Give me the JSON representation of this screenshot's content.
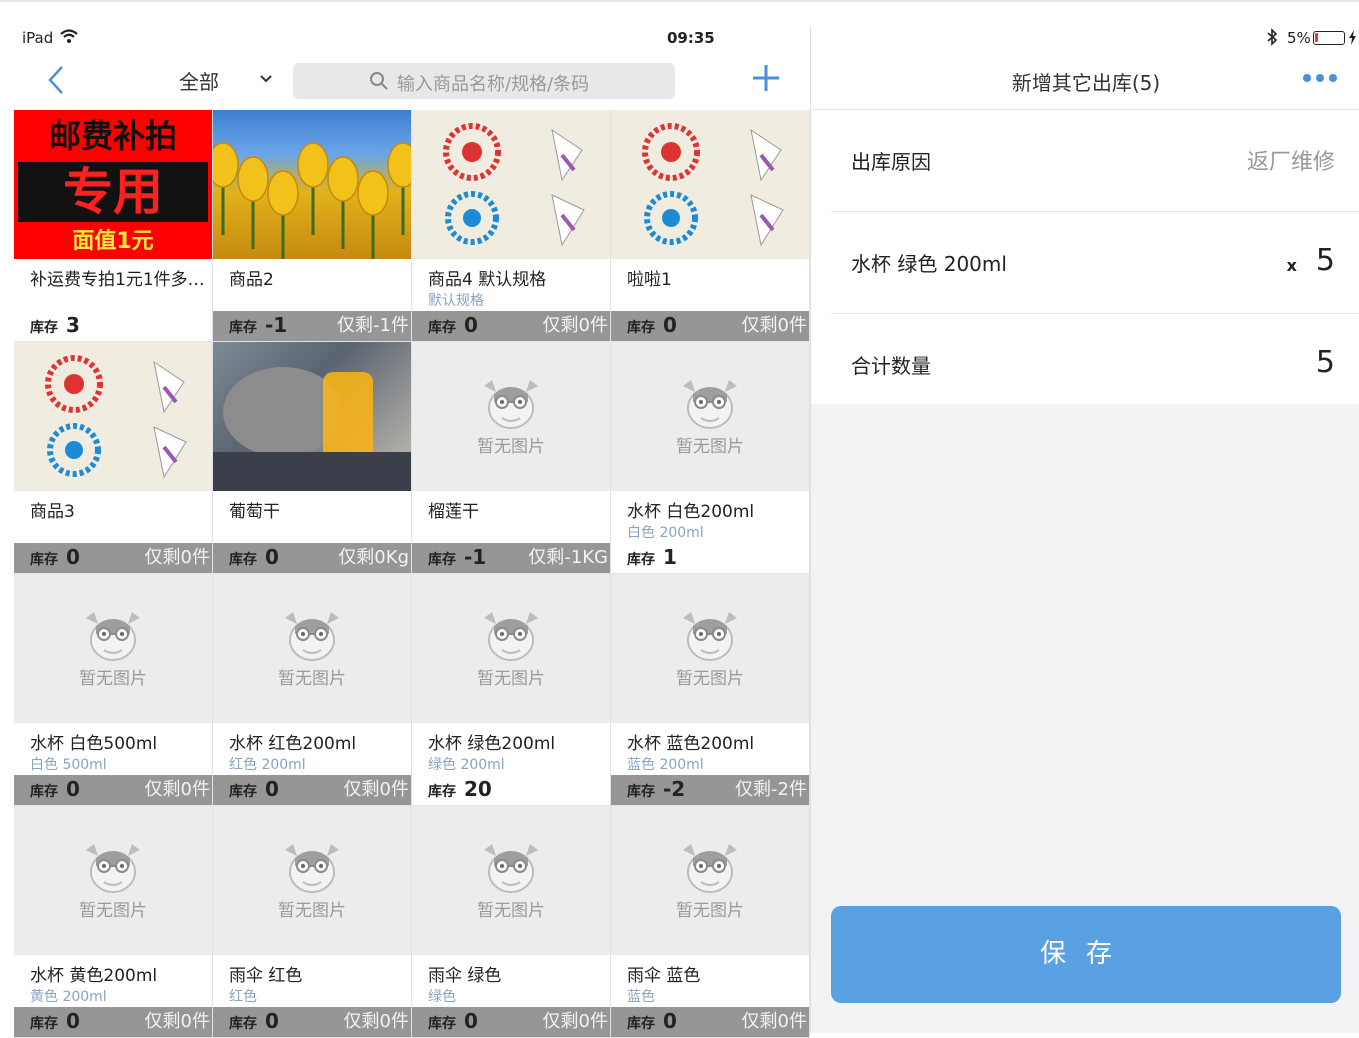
{
  "status_bar": {
    "device": "iPad",
    "time": "09:35",
    "battery_percent": "5%"
  },
  "left_nav": {
    "filter_label": "全部",
    "search_placeholder": "输入商品名称/规格/条码"
  },
  "no_image_label": "暂无图片",
  "stock_label": "库存",
  "products": [
    {
      "name": "补运费专拍1元1件多…",
      "spec": "",
      "stock": "3",
      "badge": "",
      "art": "postage",
      "art_text": [
        "邮费补拍",
        "专用",
        "面值1元"
      ]
    },
    {
      "name": "商品2",
      "spec": "",
      "stock": "-1",
      "badge": "仅剩-1件",
      "art": "tulip"
    },
    {
      "name": "商品4 默认规格",
      "spec": "默认规格",
      "stock": "0",
      "badge": "仅剩0件",
      "art": "paper"
    },
    {
      "name": "啦啦1",
      "spec": "",
      "stock": "0",
      "badge": "仅剩0件",
      "art": "paper"
    },
    {
      "name": "商品3",
      "spec": "",
      "stock": "0",
      "badge": "仅剩0件",
      "art": "paper"
    },
    {
      "name": "葡萄干",
      "spec": "",
      "stock": "0",
      "badge": "仅剩0Kg",
      "art": "photo"
    },
    {
      "name": "榴莲干",
      "spec": "",
      "stock": "-1",
      "badge": "仅剩-1KG",
      "art": "none"
    },
    {
      "name": "水杯 白色200ml",
      "spec": "白色 200ml",
      "stock": "1",
      "badge": "",
      "art": "none"
    },
    {
      "name": "水杯 白色500ml",
      "spec": "白色 500ml",
      "stock": "0",
      "badge": "仅剩0件",
      "art": "none"
    },
    {
      "name": "水杯 红色200ml",
      "spec": "红色 200ml",
      "stock": "0",
      "badge": "仅剩0件",
      "art": "none"
    },
    {
      "name": "水杯 绿色200ml",
      "spec": "绿色 200ml",
      "stock": "20",
      "badge": "",
      "art": "none"
    },
    {
      "name": "水杯 蓝色200ml",
      "spec": "蓝色 200ml",
      "stock": "-2",
      "badge": "仅剩-2件",
      "art": "none"
    },
    {
      "name": "水杯 黄色200ml",
      "spec": "黄色 200ml",
      "stock": "0",
      "badge": "仅剩0件",
      "art": "none"
    },
    {
      "name": "雨伞 红色",
      "spec": "红色",
      "stock": "0",
      "badge": "仅剩0件",
      "art": "none"
    },
    {
      "name": "雨伞 绿色",
      "spec": "绿色",
      "stock": "0",
      "badge": "仅剩0件",
      "art": "none"
    },
    {
      "name": "雨伞 蓝色",
      "spec": "蓝色",
      "stock": "0",
      "badge": "仅剩0件",
      "art": "none"
    }
  ],
  "right_panel": {
    "title": "新增其它出库(5)",
    "reason_label": "出库原因",
    "reason_value": "返厂维修",
    "item_name": "水杯 绿色 200ml",
    "item_multiplier": "x",
    "item_qty": "5",
    "total_label": "合计数量",
    "total_value": "5",
    "save_label": "保存"
  },
  "colors": {
    "accent": "#4a90d9",
    "save_button": "#5aa1e3",
    "spec_text": "#8aa3c8"
  }
}
